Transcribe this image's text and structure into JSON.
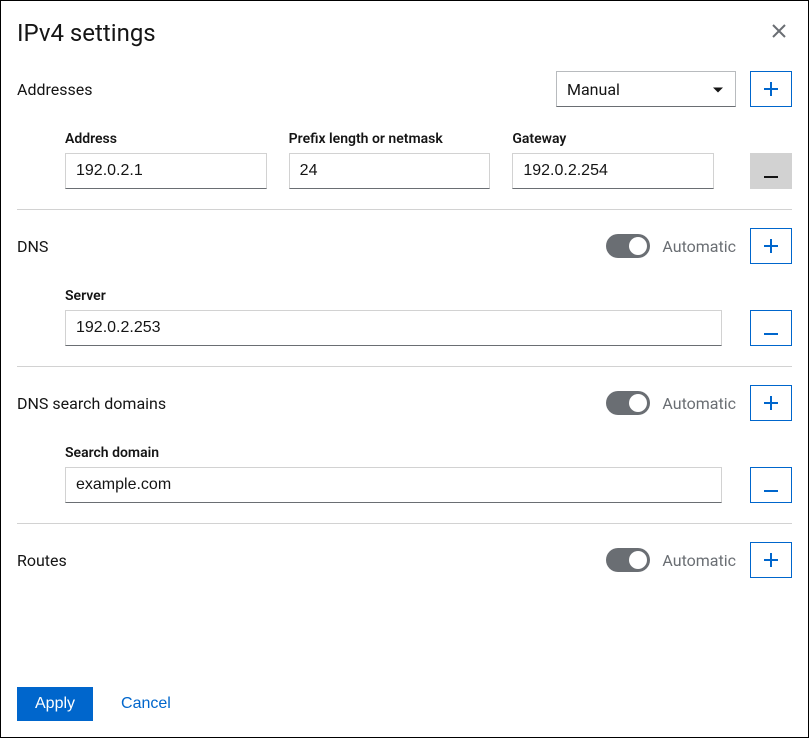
{
  "dialog": {
    "title": "IPv4 settings"
  },
  "addresses": {
    "label": "Addresses",
    "mode": "Manual",
    "columns": {
      "address": "Address",
      "prefix": "Prefix length or netmask",
      "gateway": "Gateway"
    },
    "rows": [
      {
        "address": "192.0.2.1",
        "prefix": "24",
        "gateway": "192.0.2.254"
      }
    ]
  },
  "dns": {
    "label": "DNS",
    "automatic_label": "Automatic",
    "server_label": "Server",
    "servers": [
      {
        "value": "192.0.2.253"
      }
    ]
  },
  "search_domains": {
    "label": "DNS search domains",
    "automatic_label": "Automatic",
    "field_label": "Search domain",
    "domains": [
      {
        "value": "example.com"
      }
    ]
  },
  "routes": {
    "label": "Routes",
    "automatic_label": "Automatic"
  },
  "footer": {
    "apply": "Apply",
    "cancel": "Cancel"
  }
}
